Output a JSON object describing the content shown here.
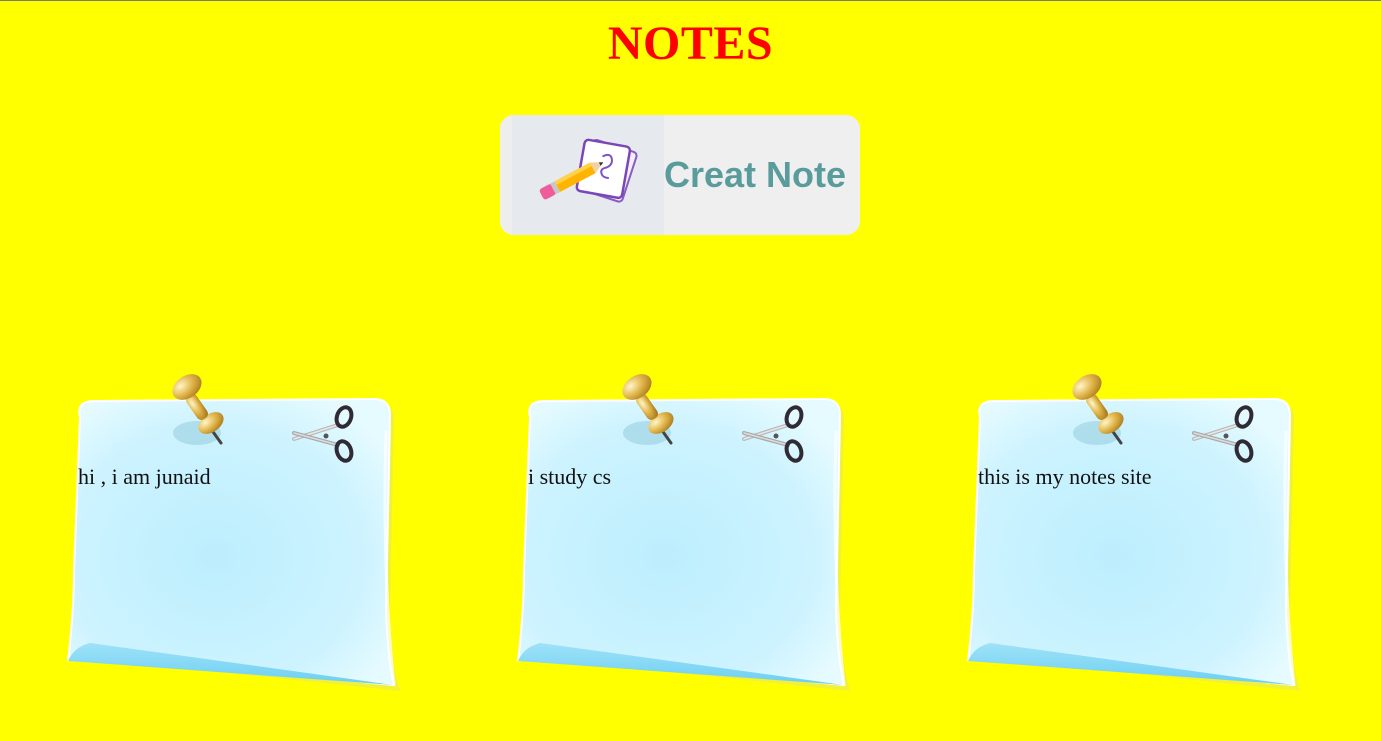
{
  "header": {
    "title": "NOTES"
  },
  "create_button": {
    "label": "Creat Note",
    "icon": "pencil-paper-icon"
  },
  "notes": [
    {
      "text": "hi , i am junaid",
      "pin_icon": "pushpin-icon",
      "delete_icon": "scissors-icon"
    },
    {
      "text": "i study cs",
      "pin_icon": "pushpin-icon",
      "delete_icon": "scissors-icon"
    },
    {
      "text": "this is my notes site",
      "pin_icon": "pushpin-icon",
      "delete_icon": "scissors-icon"
    }
  ],
  "colors": {
    "background": "#ffff00",
    "title": "#ff0000",
    "button_label": "#5a9b9b",
    "note_paper": "#c9f0ff"
  }
}
